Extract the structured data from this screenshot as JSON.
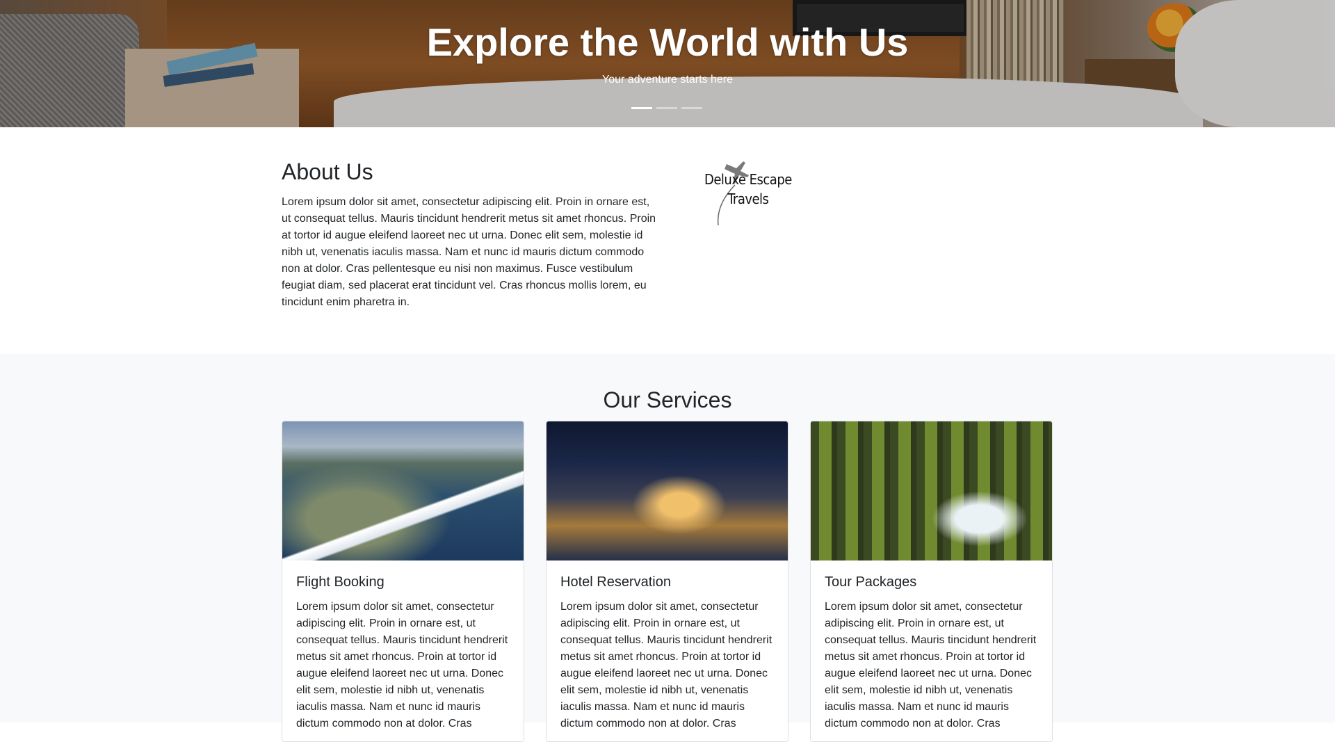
{
  "hero": {
    "title": "Explore the World with Us",
    "subtitle": "Your adventure starts here",
    "slides": 3,
    "active_slide": 1
  },
  "about": {
    "heading": "About Us",
    "body": "Lorem ipsum dolor sit amet, consectetur adipiscing elit. Proin in ornare est, ut consequat tellus. Mauris tincidunt hendrerit metus sit amet rhoncus. Proin at tortor id augue eleifend laoreet nec ut urna. Donec elit sem, molestie id nibh ut, venenatis iaculis massa. Nam et nunc id mauris dictum commodo non at dolor. Cras pellentesque eu nisi non maximus. Fusce vestibulum feugiat diam, sed placerat erat tincidunt vel. Cras rhoncus mollis lorem, eu tincidunt enim pharetra in.",
    "logo": {
      "line1": "Deluxe Escape",
      "line2": "Travels",
      "icon": "airplane-icon"
    }
  },
  "services": {
    "heading": "Our Services",
    "cards": [
      {
        "title": "Flight Booking",
        "image": "aerial-coast-from-airplane",
        "body": "Lorem ipsum dolor sit amet, consectetur adipiscing elit. Proin in ornare est, ut consequat tellus. Mauris tincidunt hendrerit metus sit amet rhoncus. Proin at tortor id augue eleifend laoreet nec ut urna. Donec elit sem, molestie id nibh ut, venenatis iaculis massa. Nam et nunc id mauris dictum commodo non at dolor. Cras"
      },
      {
        "title": "Hotel Reservation",
        "image": "seaside-hotel-at-night",
        "body": "Lorem ipsum dolor sit amet, consectetur adipiscing elit. Proin in ornare est, ut consequat tellus. Mauris tincidunt hendrerit metus sit amet rhoncus. Proin at tortor id augue eleifend laoreet nec ut urna. Donec elit sem, molestie id nibh ut, venenatis iaculis massa. Nam et nunc id mauris dictum commodo non at dolor. Cras"
      },
      {
        "title": "Tour Packages",
        "image": "mossy-forest-stream",
        "body": "Lorem ipsum dolor sit amet, consectetur adipiscing elit. Proin in ornare est, ut consequat tellus. Mauris tincidunt hendrerit metus sit amet rhoncus. Proin at tortor id augue eleifend laoreet nec ut urna. Donec elit sem, molestie id nibh ut, venenatis iaculis massa. Nam et nunc id mauris dictum commodo non at dolor. Cras"
      }
    ]
  },
  "colors": {
    "text": "#212529",
    "services_bg": "#f8f9fa",
    "hero_text": "#ffffff"
  }
}
